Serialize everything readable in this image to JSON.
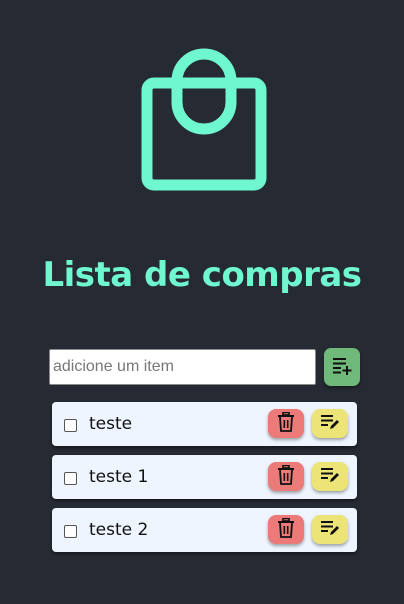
{
  "app": {
    "title": "Lista de compras",
    "logo_icon": "shopping-bag-icon",
    "accent_color": "#6ff7cf",
    "background_color": "#262a33"
  },
  "add_form": {
    "placeholder": "adicione um item",
    "value": "",
    "add_button_icon": "add-list-icon"
  },
  "items": [
    {
      "label": "teste",
      "checked": false,
      "delete_icon": "trash-icon",
      "edit_icon": "edit-list-icon"
    },
    {
      "label": "teste 1",
      "checked": false,
      "delete_icon": "trash-icon",
      "edit_icon": "edit-list-icon"
    },
    {
      "label": "teste 2",
      "checked": false,
      "delete_icon": "trash-icon",
      "edit_icon": "edit-list-icon"
    }
  ]
}
